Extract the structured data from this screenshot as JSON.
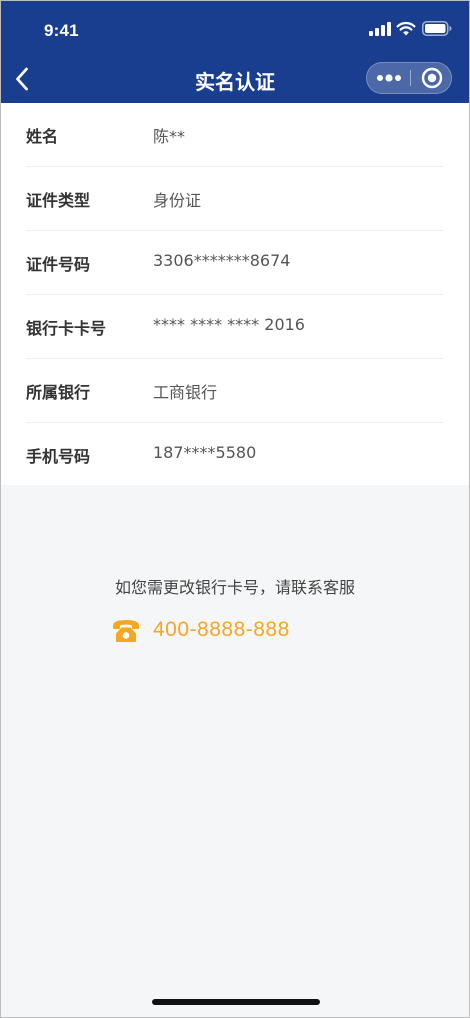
{
  "status_bar": {
    "time": "9:41"
  },
  "nav": {
    "title": "实名认证",
    "back_icon": "chevron-left-icon",
    "more_icon": "more-dots-icon",
    "close_icon": "target-circle-icon"
  },
  "colors": {
    "header_bg": "#1a3e8f",
    "page_bg": "#f5f6f7",
    "accent": "#f5a623"
  },
  "info": {
    "rows": [
      {
        "label": "姓名",
        "value": "陈**"
      },
      {
        "label": "证件类型",
        "value": "身份证"
      },
      {
        "label": "证件号码",
        "value": "3306*******8674"
      },
      {
        "label": "银行卡卡号",
        "value": "**** **** **** 2016"
      },
      {
        "label": "所属银行",
        "value": "工商银行"
      },
      {
        "label": "手机号码",
        "value": "187****5580"
      }
    ]
  },
  "notice": {
    "text": "如您需更改银行卡号，请联系客服",
    "phone_icon": "telephone-icon",
    "phone": "400-8888-888"
  }
}
